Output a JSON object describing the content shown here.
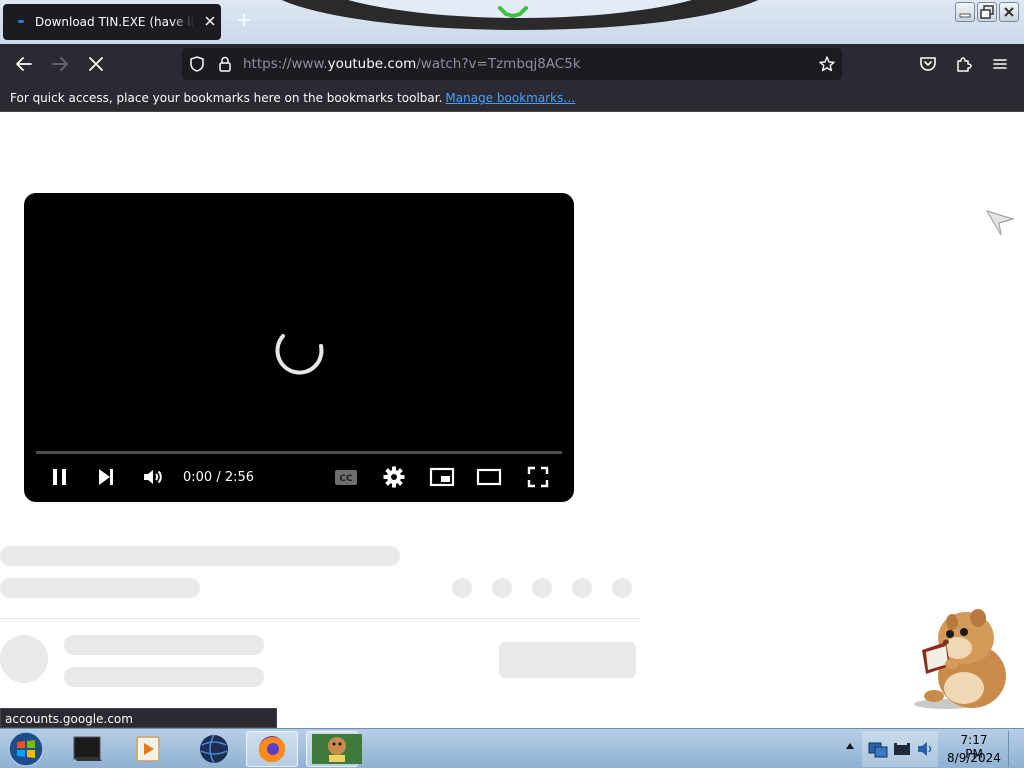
{
  "browser": {
    "tab": {
      "title": "Download TIN.EXE (have link in"
    },
    "url": {
      "prefix": "https://www.",
      "domain": "youtube.com",
      "path": "/watch?v=Tzmbqj8AC5k"
    },
    "bookmarks_bar": {
      "message": "For quick access, place your bookmarks here on the bookmarks toolbar.",
      "link": "Manage bookmarks…"
    }
  },
  "player": {
    "time": "0:00 / 2:56",
    "progress": 0,
    "state": "loading"
  },
  "status_bar": {
    "text": "accounts.google.com"
  },
  "taskbar": {
    "apps": [
      "terminal-app",
      "media-player-app",
      "globe-app",
      "firefox-app",
      "bonzi-box-app"
    ],
    "clock": {
      "time": "7:17 PM",
      "date": "8/9/2024"
    }
  },
  "colors": {
    "browser_chrome": "#2b2a33",
    "link": "#45a1ff",
    "skeleton": "#e9e9e9"
  }
}
